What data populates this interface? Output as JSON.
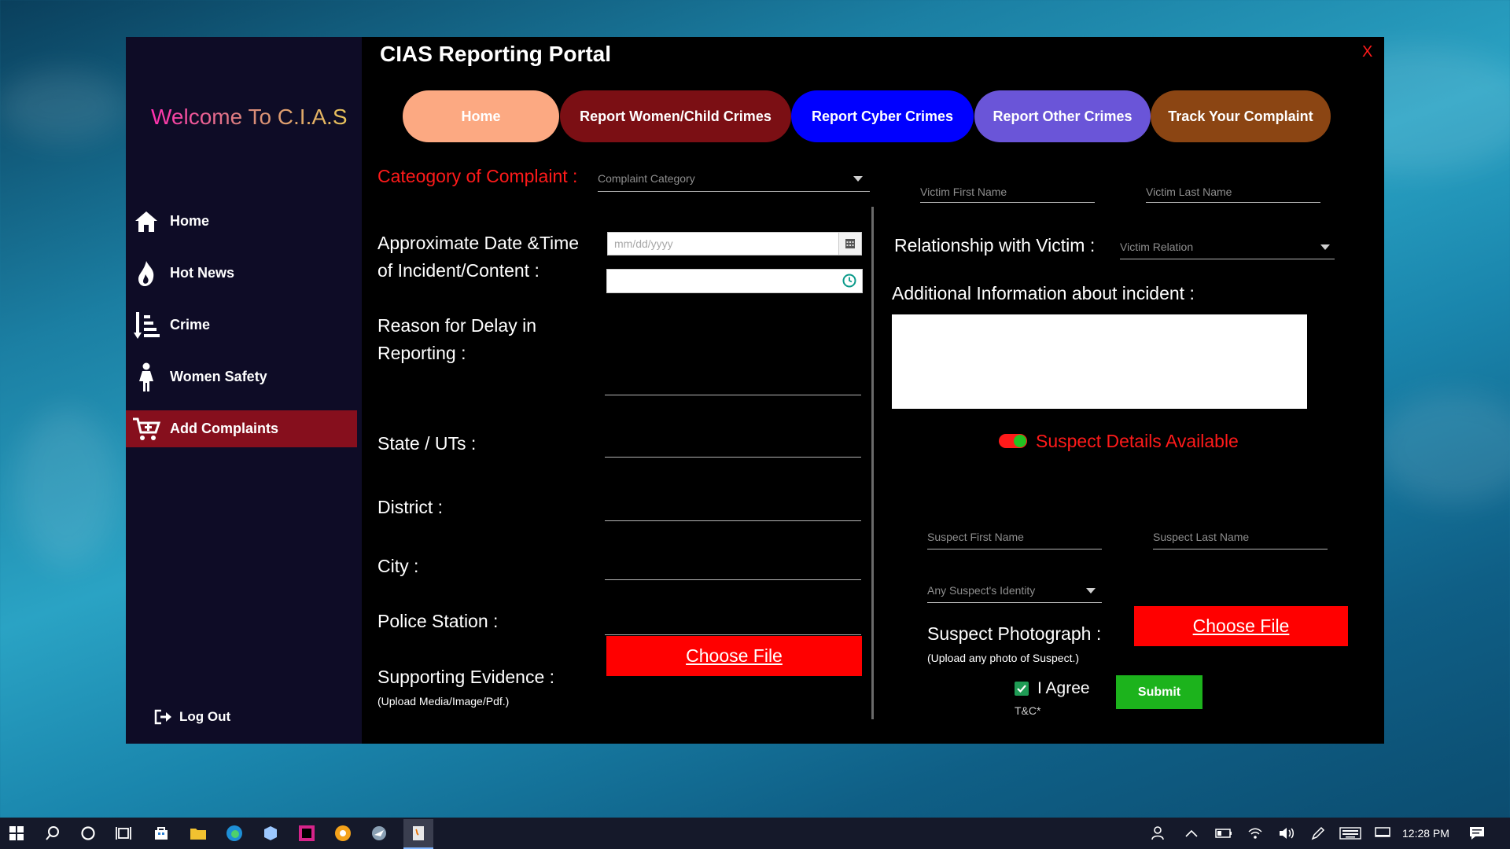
{
  "app": {
    "title": "CIAS Reporting Portal",
    "close_label": "X"
  },
  "sidebar": {
    "welcome": "Welcome To C.I.A.S",
    "items": [
      {
        "label": "Home",
        "icon": "home-icon"
      },
      {
        "label": "Hot News",
        "icon": "flame-icon"
      },
      {
        "label": "Crime",
        "icon": "sort-list-icon"
      },
      {
        "label": "Women Safety",
        "icon": "woman-icon"
      },
      {
        "label": "Add Complaints",
        "icon": "cart-plus-icon",
        "active": true
      }
    ],
    "logout": "Log Out"
  },
  "tabs": [
    {
      "label": "Home",
      "color": "#fca982"
    },
    {
      "label": "Report Women/Child Crimes",
      "color": "#7b0f14"
    },
    {
      "label": "Report Cyber Crimes",
      "color": "#0000ff"
    },
    {
      "label": "Report Other Crimes",
      "color": "#6a55d8"
    },
    {
      "label": "Track Your Complaint",
      "color": "#8b4513"
    }
  ],
  "form": {
    "category_label": "Cateogory of Complaint :",
    "category_placeholder": "Complaint Category",
    "datetime_label_line1": "Approximate Date &Time",
    "datetime_label_line2": "of Incident/Content :",
    "date_placeholder": "mm/dd/yyyy",
    "delay_label_line1": "Reason for Delay in",
    "delay_label_line2": "Reporting :",
    "state_label": "State / UTs :",
    "district_label": "District :",
    "city_label": "City :",
    "police_label": "Police Station :",
    "evidence_label": "Supporting Evidence :",
    "evidence_sub": "(Upload Media/Image/Pdf.)",
    "choose_file": "Choose File",
    "victim_first_placeholder": "Victim First Name",
    "victim_last_placeholder": "Victim Last Name",
    "relationship_label": "Relationship with Victim :",
    "relationship_placeholder": "Victim Relation",
    "additional_label": "Additional Information about incident :",
    "suspect_toggle_label": "Suspect Details Available",
    "suspect_first_placeholder": "Suspect First Name",
    "suspect_last_placeholder": "Suspect Last Name",
    "suspect_identity_placeholder": "Any Suspect's Identity",
    "suspect_photo_label": "Suspect Photograph :",
    "suspect_photo_sub": "(Upload any photo of Suspect.)",
    "suspect_choose_file": "Choose File",
    "agree_label": "I Agree",
    "tc_label": "T&C*",
    "submit": "Submit"
  },
  "taskbar": {
    "time": "12:28 PM"
  },
  "colors": {
    "accent_red": "#ff0000",
    "active_nav": "#860f1d",
    "submit_green": "#1cb31c"
  }
}
